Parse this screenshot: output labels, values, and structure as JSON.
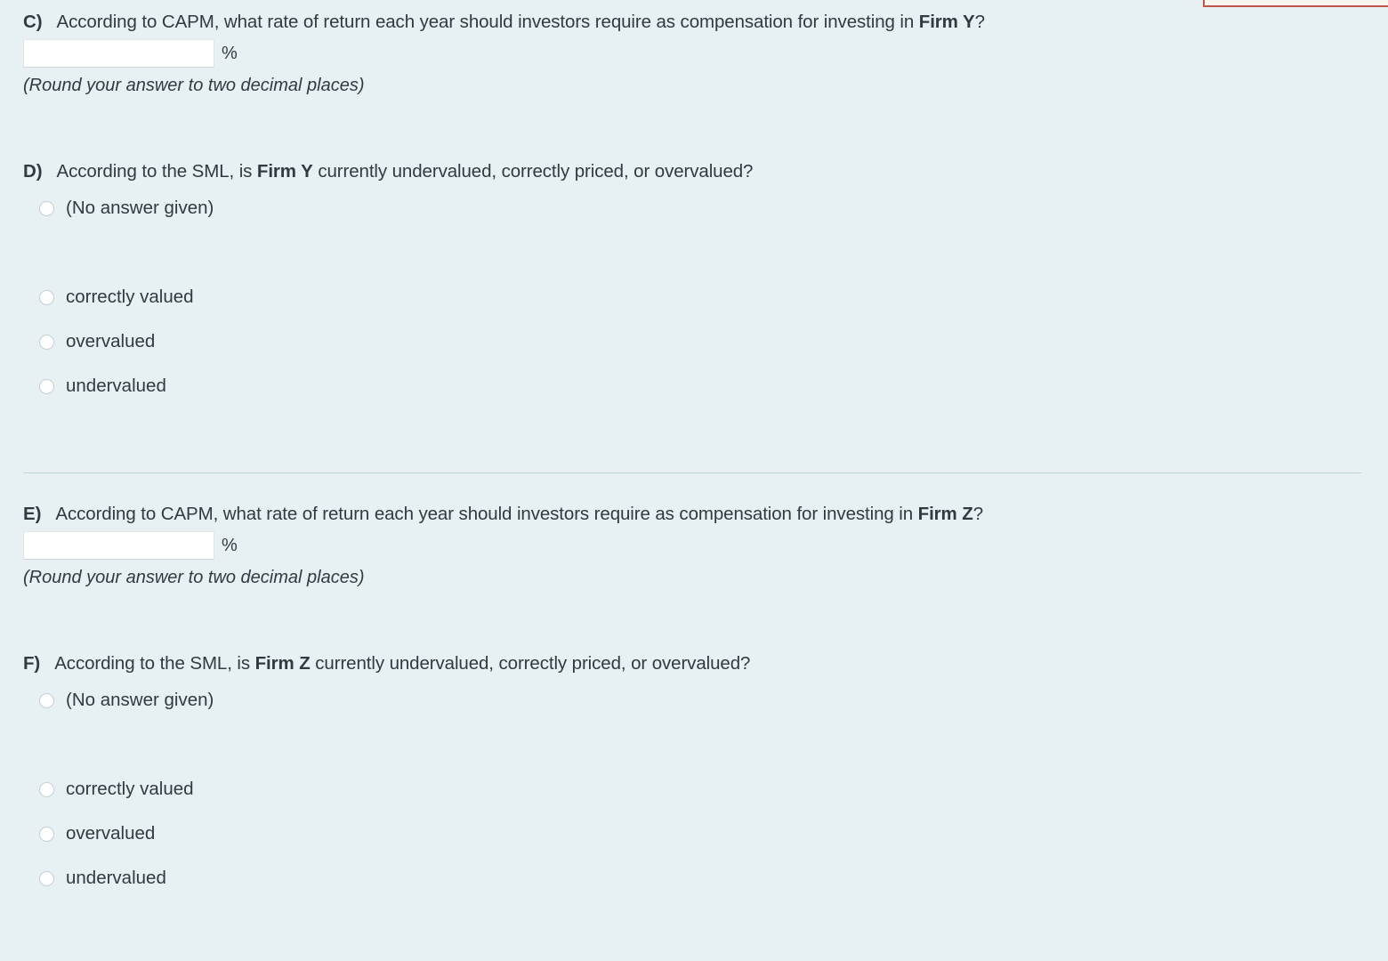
{
  "background_color": "#e7f1f3",
  "text_color": "#2f3b41",
  "divider_color": "#bcd7d8",
  "alert_box": {
    "name": "clipped-alert-box",
    "border_color": "#c0564a",
    "fill_color": "#fdf7f0"
  },
  "questions": [
    {
      "label": "C)",
      "text_before": "According to CAPM, what rate of return each year should investors require as compensation for investing in ",
      "firm": "Firm Y",
      "text_after": "?",
      "input_value": "",
      "input_placeholder": "",
      "unit": "%",
      "hint": "(Round your answer to two decimal places)"
    },
    {
      "label": "D)",
      "text_before": "According to the SML, is ",
      "firm": "Firm Y",
      "text_after": " currently undervalued, correctly priced, or overvalued?",
      "options": [
        "(No answer given)",
        "correctly valued",
        "overvalued",
        "undervalued"
      ]
    },
    {
      "label": "E)",
      "text_before": "According to CAPM, what rate of return each year should investors require as compensation for investing in ",
      "firm": "Firm Z",
      "text_after": "?",
      "input_value": "",
      "input_placeholder": "",
      "unit": "%",
      "hint": "(Round your answer to two decimal places)"
    },
    {
      "label": "F)",
      "text_before": "According to the SML, is ",
      "firm": "Firm Z",
      "text_after": " currently undervalued, correctly priced, or overvalued?",
      "options": [
        "(No answer given)",
        "correctly valued",
        "overvalued",
        "undervalued"
      ]
    }
  ]
}
